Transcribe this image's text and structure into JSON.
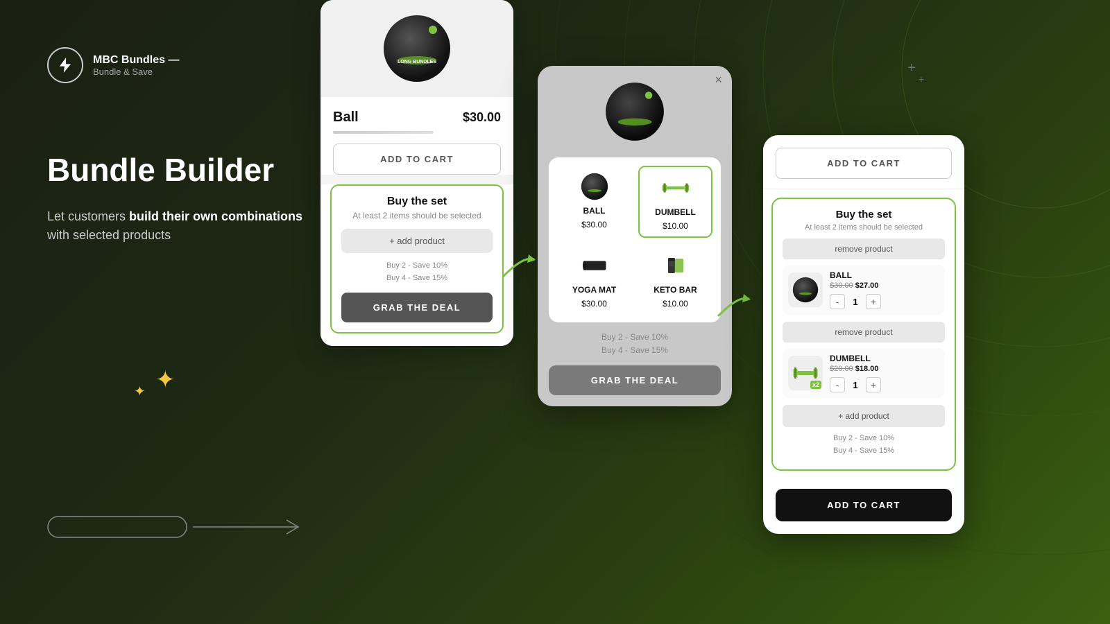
{
  "logo": {
    "title": "MBC Bundles —",
    "subtitle": "Bundle & Save"
  },
  "hero": {
    "heading": "Bundle Builder",
    "body_prefix": "Let customers ",
    "body_bold": "build their own combinations",
    "body_suffix": " with selected products"
  },
  "card1": {
    "product_name": "Ball",
    "product_price": "$30.00",
    "add_to_cart_label": "ADD TO CART",
    "bundle_title": "Buy the set",
    "bundle_subtitle": "At least 2 items should be selected",
    "add_product_label": "+ add product",
    "savings_line1": "Buy 2 - Save 10%",
    "savings_line2": "Buy 4 - Save 15%",
    "grab_deal_label": "GRAB THE DEAL"
  },
  "card2": {
    "close_label": "×",
    "grid_items": [
      {
        "name": "BALL",
        "price": "$30.00",
        "selected": false
      },
      {
        "name": "DUMBELL",
        "price": "$10.00",
        "selected": true
      },
      {
        "name": "YOGA MAT",
        "price": "$30.00",
        "selected": false
      },
      {
        "name": "KETO BAR",
        "price": "$10.00",
        "selected": false
      }
    ],
    "savings_line1": "Buy 2 - Save 10%",
    "savings_line2": "Buy 4 - Save 15%",
    "grab_deal_label": "GRAB THE DEAL"
  },
  "card3": {
    "add_to_cart_top_label": "ADD TO CART",
    "bundle_title": "Buy the set",
    "bundle_subtitle": "At least 2 items should be selected",
    "remove_product_label": "remove product",
    "products": [
      {
        "name": "BALL",
        "old_price": "$30.00",
        "new_price": "$27.00",
        "qty": 1,
        "badge": null
      },
      {
        "name": "DUMBELL",
        "old_price": "$20.00",
        "new_price": "$18.00",
        "qty": 1,
        "badge": "x2"
      }
    ],
    "add_product_label": "+ add product",
    "savings_line1": "Buy 2 - Save 10%",
    "savings_line2": "Buy 4 - Save 15%",
    "add_to_cart_bottom_label": "ADD TO CART"
  },
  "decorations": {
    "plus1": "+",
    "plus2": "+"
  }
}
